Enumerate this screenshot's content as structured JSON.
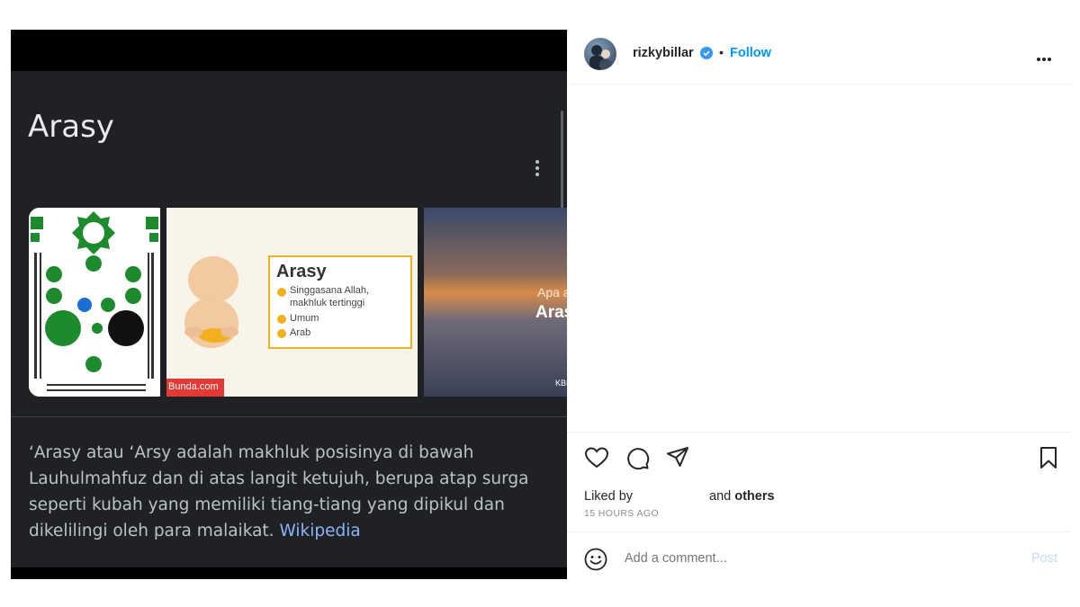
{
  "media": {
    "card_title": "Arasy",
    "thumb2": {
      "heading": "Arasy",
      "line1": "Singgasana Allah,",
      "line2": "makhluk tertinggi",
      "line3": "Umum",
      "line4": "Arab",
      "source": "Bunda.com"
    },
    "thumb3": {
      "line1": "Apa a",
      "line2": "Aras",
      "source": "KBI"
    },
    "description": "‘Arasy atau ‘Arsy adalah makhluk posisinya di bawah Lauhulmahfuz dan di atas langit ketujuh, berupa atap surga seperti kubah yang memiliki tiang-tiang yang dipikul dan dikelilingi oleh para malaikat.",
    "source_link": "Wikipedia"
  },
  "header": {
    "username": "rizkybillar",
    "separator": "•",
    "follow_label": "Follow"
  },
  "engagement": {
    "liked_by": "Liked by",
    "and_label": "and",
    "others_label": "others",
    "timestamp": "15 HOURS AGO"
  },
  "comment": {
    "placeholder": "Add a comment...",
    "post_label": "Post"
  },
  "colors": {
    "accent": "#0095f6",
    "card_bg": "#202124",
    "link": "#8ab4f8"
  }
}
